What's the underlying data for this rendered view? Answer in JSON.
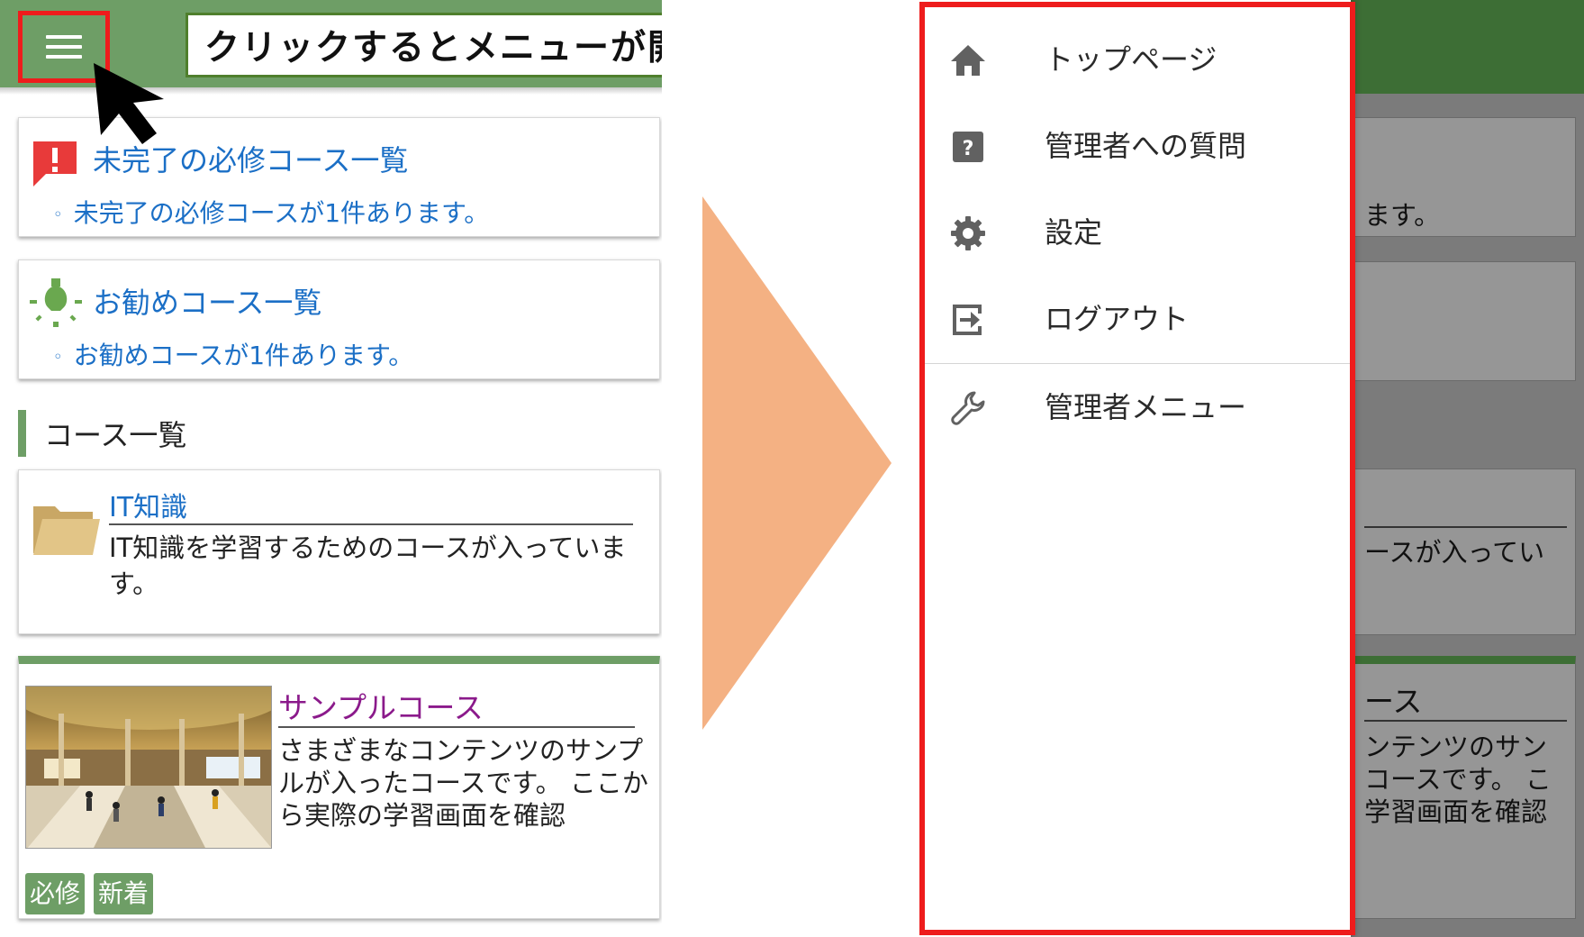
{
  "callout": {
    "text": "クリックするとメニューが開きます"
  },
  "home": {
    "required_card": {
      "title": "未完了の必修コース一覧",
      "bullet": "◦",
      "description": "未完了の必修コースが1件あります。"
    },
    "recommend_card": {
      "title": "お勧めコース一覧",
      "bullet": "◦",
      "description": "お勧めコースが1件あります。"
    },
    "section_title": "コース一覧",
    "courses": [
      {
        "title": "IT知識",
        "description": "IT知識を学習するためのコースが入っています。"
      },
      {
        "title": "サンプルコース",
        "description": "さまざまなコンテンツのサンプルが入ったコースです。 ここから実際の学習画面を確認",
        "tags": [
          "必修",
          "新着"
        ]
      }
    ]
  },
  "behind": {
    "line1": "ます。",
    "line2": "ースが入ってい",
    "title_fragment": "ース",
    "desc1": "ンテンツのサン",
    "desc2": "コースです。 こ",
    "desc3": "学習画面を確認"
  },
  "drawer": {
    "items": [
      {
        "label": "トップページ",
        "icon": "home-icon"
      },
      {
        "label": "管理者への質問",
        "icon": "question-icon"
      },
      {
        "label": "設定",
        "icon": "gear-icon"
      },
      {
        "label": "ログアウト",
        "icon": "logout-icon"
      },
      {
        "label": "管理者メニュー",
        "icon": "wrench-icon"
      }
    ]
  },
  "colors": {
    "header_green": "#6e9e66",
    "link_blue": "#1b6fc6",
    "course_purple": "#8b1a8b",
    "highlight_red": "#ee1c1c",
    "arrow_orange": "#f4b183"
  }
}
